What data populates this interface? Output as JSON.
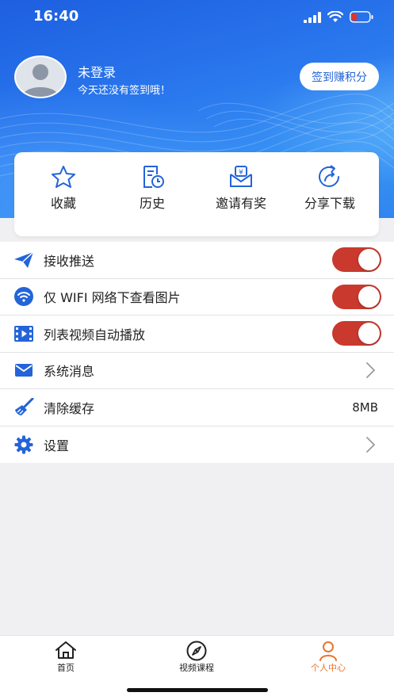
{
  "status_bar": {
    "time": "16:40"
  },
  "user": {
    "name": "未登录",
    "subtitle": "今天还没有签到哦！",
    "checkin_label": "签到赚积分"
  },
  "quick_actions": [
    {
      "label": "收藏",
      "icon": "star-icon"
    },
    {
      "label": "历史",
      "icon": "history-icon"
    },
    {
      "label": "邀请有奖",
      "icon": "invite-reward-icon"
    },
    {
      "label": "分享下载",
      "icon": "share-icon"
    }
  ],
  "settings": [
    {
      "label": "接收推送",
      "icon": "paper-plane-icon",
      "control": "toggle",
      "on": true
    },
    {
      "label": "仅 WIFI 网络下查看图片",
      "icon": "wifi-icon",
      "control": "toggle",
      "on": true
    },
    {
      "label": "列表视频自动播放",
      "icon": "video-icon",
      "control": "toggle",
      "on": true
    },
    {
      "label": "系统消息",
      "icon": "mail-icon",
      "control": "chevron"
    },
    {
      "label": "清除缓存",
      "icon": "broom-icon",
      "control": "value",
      "value": "8MB"
    },
    {
      "label": "设置",
      "icon": "gear-icon",
      "control": "chevron"
    }
  ],
  "tabs": [
    {
      "label": "首页",
      "icon": "home-icon",
      "active": false
    },
    {
      "label": "视频课程",
      "icon": "compass-icon",
      "active": false
    },
    {
      "label": "个人中心",
      "icon": "person-icon",
      "active": true
    }
  ],
  "colors": {
    "accent_blue": "#2364d8",
    "toggle_on": "#c9392e",
    "active_tab": "#e8762a"
  }
}
